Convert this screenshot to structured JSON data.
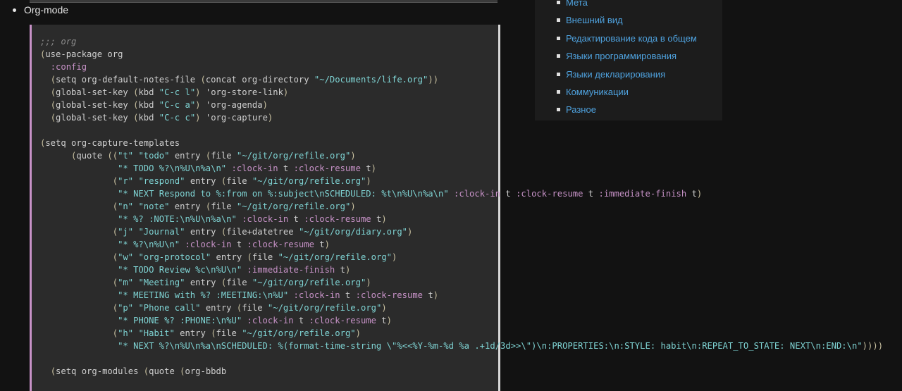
{
  "bullet": {
    "label": "Org-mode"
  },
  "sidebar": {
    "items": [
      {
        "label": "Мета"
      },
      {
        "label": "Внешний вид"
      },
      {
        "label": "Редактирование кода в общем"
      },
      {
        "label": "Языки программирования"
      },
      {
        "label": "Языки декларирования"
      },
      {
        "label": "Коммуникации"
      },
      {
        "label": "Разное"
      }
    ]
  },
  "code": {
    "lines": [
      ";;; org",
      "(use-package org",
      "  :config",
      "  (setq org-default-notes-file (concat org-directory \"~/Documents/life.org\"))",
      "  (global-set-key (kbd \"C-c l\") 'org-store-link)",
      "  (global-set-key (kbd \"C-c a\") 'org-agenda)",
      "  (global-set-key (kbd \"C-c c\") 'org-capture)",
      "",
      "(setq org-capture-templates",
      "      (quote ((\"t\" \"todo\" entry (file \"~/git/org/refile.org\")",
      "               \"* TODO %?\\n%U\\n%a\\n\" :clock-in t :clock-resume t)",
      "              (\"r\" \"respond\" entry (file \"~/git/org/refile.org\")",
      "               \"* NEXT Respond to %:from on %:subject\\nSCHEDULED: %t\\n%U\\n%a\\n\" :clock-in t :clock-resume t :immediate-finish t)",
      "              (\"n\" \"note\" entry (file \"~/git/org/refile.org\")",
      "               \"* %? :NOTE:\\n%U\\n%a\\n\" :clock-in t :clock-resume t)",
      "              (\"j\" \"Journal\" entry (file+datetree \"~/git/org/diary.org\")",
      "               \"* %?\\n%U\\n\" :clock-in t :clock-resume t)",
      "              (\"w\" \"org-protocol\" entry (file \"~/git/org/refile.org\")",
      "               \"* TODO Review %c\\n%U\\n\" :immediate-finish t)",
      "              (\"m\" \"Meeting\" entry (file \"~/git/org/refile.org\")",
      "               \"* MEETING with %? :MEETING:\\n%U\" :clock-in t :clock-resume t)",
      "              (\"p\" \"Phone call\" entry (file \"~/git/org/refile.org\")",
      "               \"* PHONE %? :PHONE:\\n%U\" :clock-in t :clock-resume t)",
      "              (\"h\" \"Habit\" entry (file \"~/git/org/refile.org\")",
      "               \"* NEXT %?\\n%U\\n%a\\nSCHEDULED: %(format-time-string \\\"%<<%Y-%m-%d %a .+1d/3d>>\\\")\\n:PROPERTIES:\\n:STYLE: habit\\n:REPEAT_TO_STATE: NEXT\\n:END:\\n\"))))",
      "",
      "  (setq org-modules (quote (org-bbdb"
    ]
  },
  "colors": {
    "background": "#121212",
    "code_background": "#2b2b2b",
    "code_border_left": "#c792c7",
    "link": "#4fa3e0",
    "string": "#7fd4d4",
    "keyword_arg": "#c792c7",
    "comment": "#8a8a8a"
  }
}
